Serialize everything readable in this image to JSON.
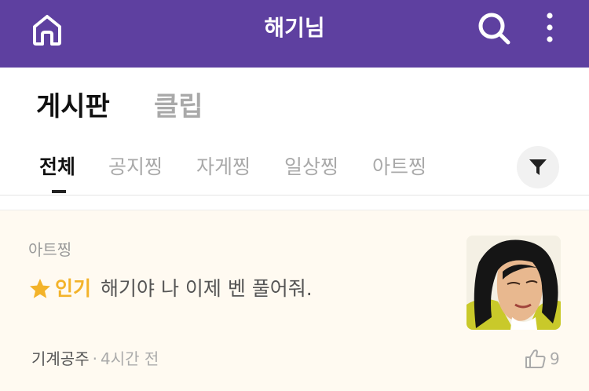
{
  "header": {
    "title": "해기님",
    "icons": {
      "home": "home-icon",
      "search": "search-icon",
      "more": "more-vertical-icon"
    },
    "background": "#5e40a0"
  },
  "main_tabs": [
    {
      "label": "게시판",
      "active": true
    },
    {
      "label": "클립",
      "active": false
    }
  ],
  "sub_tabs": [
    {
      "label": "전체",
      "active": true
    },
    {
      "label": "공지찡",
      "active": false
    },
    {
      "label": "자게찡",
      "active": false
    },
    {
      "label": "일상찡",
      "active": false
    },
    {
      "label": "아트찡",
      "active": false
    }
  ],
  "filter": {
    "icon": "filter-icon"
  },
  "posts": [
    {
      "category": "아트찡",
      "badge": "인기",
      "title": "해기야 나 이제 벤 풀어줘.",
      "author": "기계공주",
      "separator": "·",
      "time": "4시간 전",
      "likes": "9",
      "badge_color": "#f3b32a"
    }
  ]
}
